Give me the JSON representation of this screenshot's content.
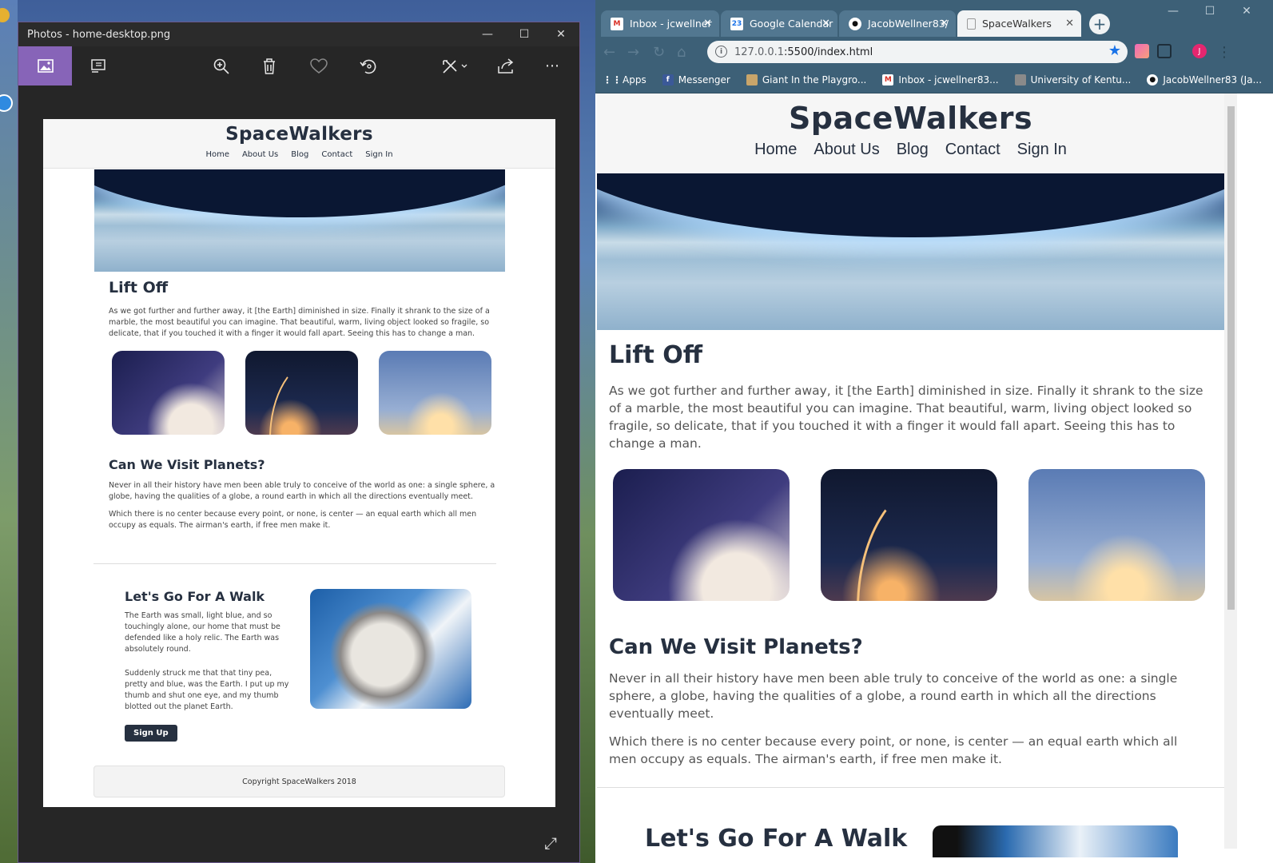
{
  "photos": {
    "title": "Photos - home-desktop.png",
    "site": {
      "brand": "SpaceWalkers",
      "nav": [
        "Home",
        "About Us",
        "Blog",
        "Contact",
        "Sign In"
      ],
      "liftoff_title": "Lift Off",
      "liftoff_text": "As we got further and further away, it [the Earth] diminished in size. Finally it shrank to the size of a marble, the most beautiful you can imagine. That beautiful, warm, living object looked so fragile, so delicate, that if you touched it with a finger it would fall apart. Seeing this has to change a man.",
      "planets_title": "Can We Visit Planets?",
      "planets_p1": "Never in all their history have men been able truly to conceive of the world as one: a single sphere, a globe, having the qualities of a globe, a round earth in which all the directions eventually meet.",
      "planets_p2": "Which there is no center because every point, or none, is center — an equal earth which all men occupy as equals. The airman's earth, if free men make it.",
      "walk_title": "Let's Go For A Walk",
      "walk_p1": "The Earth was small, light blue, and so touchingly alone, our home that must be defended like a holy relic. The Earth was absolutely round.",
      "walk_p2": "Suddenly struck me that that tiny pea, pretty and blue, was the Earth. I put up my thumb and shut one eye, and my thumb blotted out the planet Earth.",
      "signup": "Sign Up",
      "footer": "Copyright SpaceWalkers 2018"
    }
  },
  "chrome": {
    "tabs": [
      {
        "label": "Inbox - jcwellner",
        "icon": "gmail-icon"
      },
      {
        "label": "Google Calendar",
        "icon": "calendar-icon",
        "badge": "23"
      },
      {
        "label": "JacobWellner83/",
        "icon": "github-icon"
      },
      {
        "label": "SpaceWalkers",
        "icon": "page-icon"
      }
    ],
    "url_host": "127.0.0.1",
    "url_path": ":5500/index.html",
    "avatar": "J",
    "bookmarks": [
      {
        "label": "Apps",
        "icon": "apps-icon"
      },
      {
        "label": "Messenger",
        "icon": "facebook-icon"
      },
      {
        "label": "Giant In the Playgro...",
        "icon": "bookmark-image-icon"
      },
      {
        "label": "Inbox - jcwellner83...",
        "icon": "gmail-icon"
      },
      {
        "label": "University of Kentu...",
        "icon": "bookmark-image-icon"
      },
      {
        "label": "JacobWellner83 (Ja...",
        "icon": "github-icon"
      }
    ],
    "page": {
      "brand": "SpaceWalkers",
      "nav": [
        "Home",
        "About Us",
        "Blog",
        "Contact",
        "Sign In"
      ],
      "liftoff_title": "Lift Off",
      "liftoff_text": "As we got further and further away, it [the Earth] diminished in size. Finally it shrank to the size of a marble, the most beautiful you can imagine. That beautiful, warm, living object looked so fragile, so delicate, that if you touched it with a finger it would fall apart. Seeing this has to change a man.",
      "planets_title": "Can We Visit Planets?",
      "planets_p1": "Never in all their history have men been able truly to conceive of the world as one: a single sphere, a globe, having the qualities of a globe, a round earth in which all the directions eventually meet.",
      "planets_p2": "Which there is no center because every point, or none, is center — an equal earth which all men occupy as equals. The airman's earth, if free men make it.",
      "walk_title": "Let's Go For A Walk"
    }
  },
  "colors": {
    "brand_dark": "#263040",
    "photos_accent": "#8764b8",
    "chrome_frame": "#3d6077"
  }
}
